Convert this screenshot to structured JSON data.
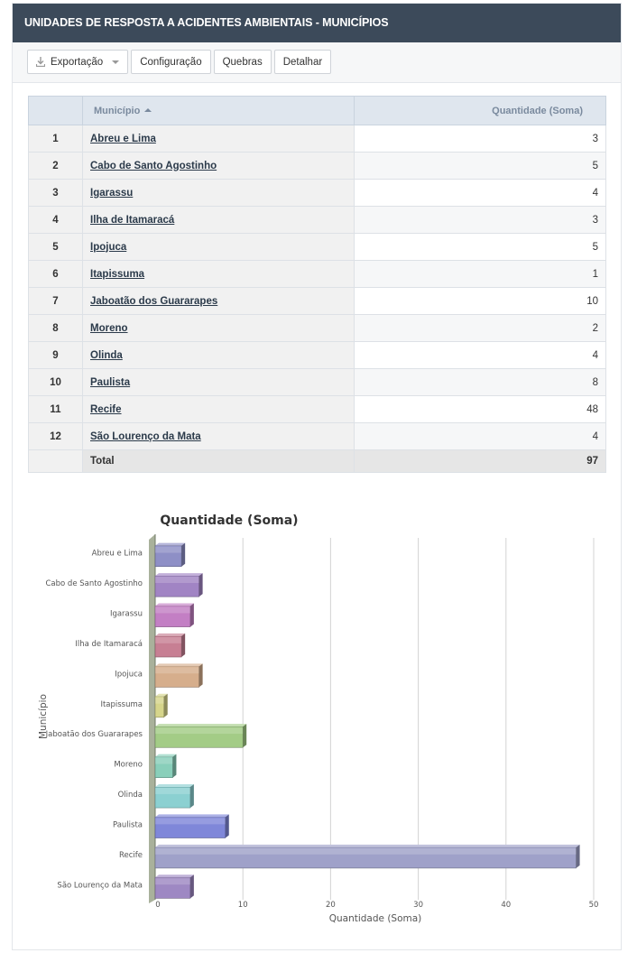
{
  "header": {
    "title": "UNIDADES DE RESPOSTA A ACIDENTES AMBIENTAIS - MUNICÍPIOS"
  },
  "toolbar": {
    "export_label": "Exportação",
    "config_label": "Configuração",
    "breaks_label": "Quebras",
    "detail_label": "Detalhar"
  },
  "table": {
    "columns": {
      "municipio": "Município",
      "quantidade": "Quantidade (Soma)"
    },
    "rows": [
      {
        "index": "1",
        "municipio": "Abreu e Lima",
        "quantidade": "3"
      },
      {
        "index": "2",
        "municipio": "Cabo de Santo Agostinho",
        "quantidade": "5"
      },
      {
        "index": "3",
        "municipio": "Igarassu",
        "quantidade": "4"
      },
      {
        "index": "4",
        "municipio": "Ilha de Itamaracá",
        "quantidade": "3"
      },
      {
        "index": "5",
        "municipio": "Ipojuca",
        "quantidade": "5"
      },
      {
        "index": "6",
        "municipio": "Itapissuma",
        "quantidade": "1"
      },
      {
        "index": "7",
        "municipio": "Jaboatão dos Guararapes",
        "quantidade": "10"
      },
      {
        "index": "8",
        "municipio": "Moreno",
        "quantidade": "2"
      },
      {
        "index": "9",
        "municipio": "Olinda",
        "quantidade": "4"
      },
      {
        "index": "10",
        "municipio": "Paulista",
        "quantidade": "8"
      },
      {
        "index": "11",
        "municipio": "Recife",
        "quantidade": "48"
      },
      {
        "index": "12",
        "municipio": "São Lourenço da Mata",
        "quantidade": "4"
      }
    ],
    "total_label": "Total",
    "total_value": "97"
  },
  "chart_data": {
    "type": "bar",
    "orientation": "horizontal",
    "title": "Quantidade (Soma)",
    "xlabel": "Quantidade (Soma)",
    "ylabel": "Município",
    "categories": [
      "Abreu e Lima",
      "Cabo de Santo Agostinho",
      "Igarassu",
      "Ilha de Itamaracá",
      "Ipojuca",
      "Itapissuma",
      "Jaboatão dos Guararapes",
      "Moreno",
      "Olinda",
      "Paulista",
      "Recife",
      "São Lourenço da Mata"
    ],
    "values": [
      3,
      5,
      4,
      3,
      5,
      1,
      10,
      2,
      4,
      8,
      48,
      4
    ],
    "xlim": [
      0,
      50
    ],
    "xticks": [
      0,
      10,
      20,
      30,
      40,
      50
    ],
    "grid": true,
    "style": "3d",
    "colors": [
      "#8e8fc6",
      "#a184c4",
      "#c37fc4",
      "#c77f93",
      "#d6ae8c",
      "#d6d58b",
      "#a3cc86",
      "#89cfba",
      "#8bd0d1",
      "#7f87d9",
      "#9fa1c9",
      "#9e88c3"
    ]
  }
}
